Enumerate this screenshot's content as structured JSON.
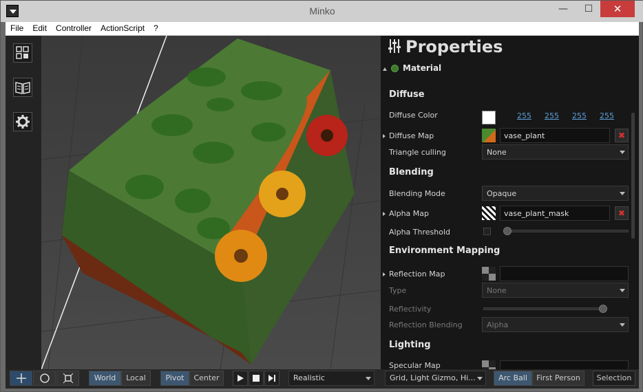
{
  "window": {
    "title": "Minko",
    "min": "—",
    "max": "☐",
    "close": "✕"
  },
  "menu": [
    {
      "label": "File"
    },
    {
      "label": "Edit"
    },
    {
      "label": "Controller"
    },
    {
      "label": "ActionScript"
    },
    {
      "label": "?"
    }
  ],
  "properties": {
    "title": "Properties",
    "material_label": "Material",
    "diffuse": {
      "section": "Diffuse",
      "color_label": "Diffuse Color",
      "color": [
        "255",
        "255",
        "255",
        "255"
      ],
      "map_label": "Diffuse Map",
      "map_value": "vase_plant",
      "culling_label": "Triangle culling",
      "culling_value": "None"
    },
    "blending": {
      "section": "Blending",
      "mode_label": "Blending Mode",
      "mode_value": "Opaque",
      "alpha_map_label": "Alpha Map",
      "alpha_map_value": "vase_plant_mask",
      "threshold_label": "Alpha Threshold",
      "threshold_level": 0
    },
    "environment": {
      "section": "Environment Mapping",
      "reflection_map_label": "Reflection Map",
      "reflection_map_value": "",
      "type_label": "Type",
      "type_value": "None",
      "reflectivity_label": "Reflectivity",
      "reflectivity_level": 1,
      "reflection_blending_label": "Reflection Blending",
      "reflection_blending_value": "Alpha"
    },
    "lighting": {
      "section": "Lighting",
      "specular_map_label": "Specular Map"
    }
  },
  "toolbar": {
    "world": "World",
    "local": "Local",
    "pivot": "Pivot",
    "center": "Center",
    "render_mode": "Realistic",
    "display": "Grid, Light Gizmo, Hi...",
    "arc_ball": "Arc Ball",
    "first_person": "First Person",
    "selection": "Selection"
  },
  "colors": {
    "accent": "#3d5770",
    "close": "#c83c3c",
    "link": "#5b9fd8",
    "delete": "#d83030"
  }
}
